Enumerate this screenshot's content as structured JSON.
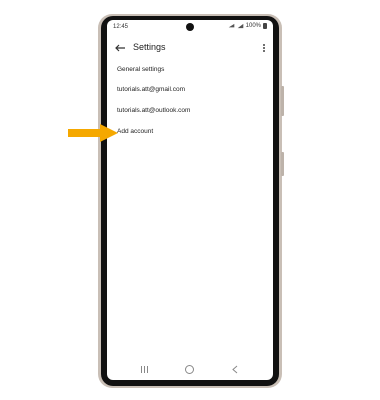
{
  "status_bar": {
    "time": "12:45",
    "battery": "100%"
  },
  "app_bar": {
    "title": "Settings",
    "back_icon": "arrow-back-icon",
    "more_icon": "more-vert-icon"
  },
  "settings_list": {
    "items": [
      {
        "label": "General settings"
      },
      {
        "label": "tutorials.att@gmail.com"
      },
      {
        "label": "tutorials.att@outlook.com"
      },
      {
        "label": "Add account"
      }
    ]
  },
  "nav_bar": {
    "icons": [
      "recents-icon",
      "home-icon",
      "back-icon"
    ]
  },
  "colors": {
    "pointer_arrow": "#f5a800",
    "phone_frame": "#c9bfb6",
    "bezel": "#111111"
  }
}
